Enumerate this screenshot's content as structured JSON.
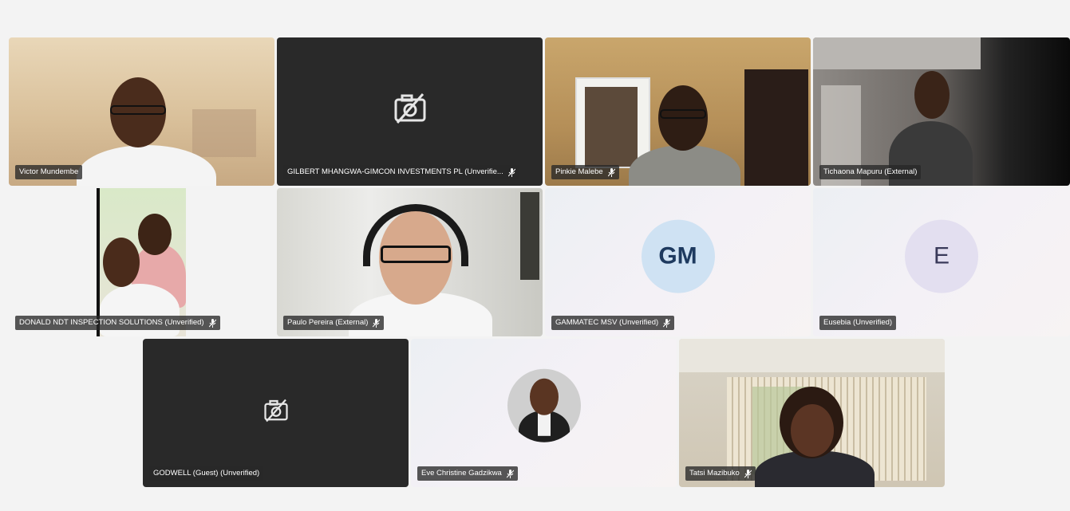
{
  "participants": [
    {
      "name": "Victor Mundembe",
      "mic_muted": false
    },
    {
      "name": "GILBERT MHANGWA-GIMCON INVESTMENTS PL (Unverifie...",
      "mic_muted": true
    },
    {
      "name": "Pinkie Malebe",
      "mic_muted": true
    },
    {
      "name": "Tichaona Mapuru (External)",
      "mic_muted": false
    },
    {
      "name": "DONALD NDT INSPECTION SOLUTIONS (Unverified)",
      "mic_muted": true
    },
    {
      "name": "Paulo Pereira (External)",
      "mic_muted": true
    },
    {
      "name": "GAMMATEC MSV (Unverified)",
      "mic_muted": true,
      "initials": "GM"
    },
    {
      "name": "Eusebia (Unverified)",
      "mic_muted": false,
      "initials": "E"
    },
    {
      "name": "GODWELL (Guest) (Unverified)",
      "mic_muted": false
    },
    {
      "name": "Eve Christine Gadzikwa",
      "mic_muted": true
    },
    {
      "name": "Tatsi Mazibuko",
      "mic_muted": true
    }
  ],
  "colors": {
    "stage_bg": "#f3f3f3",
    "tile_dark": "#292929",
    "name_tag_bg": "#282828",
    "gm_avatar_bg": "#cfe2f3",
    "e_avatar_bg": "#e3dff0"
  },
  "icons": {
    "camera_off": "video-off-icon",
    "mic_off": "mic-off-icon"
  }
}
